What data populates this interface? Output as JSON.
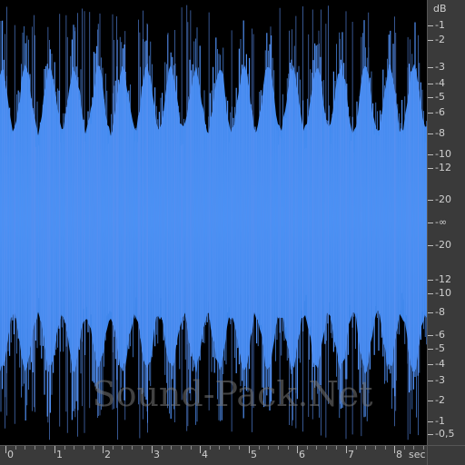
{
  "colors": {
    "waveform": "#4f8ff2",
    "waveform_core": "#3f88ee",
    "background": "#000000",
    "ruler_bg": "#3a3a3a",
    "label": "#cfcfcf"
  },
  "db_scale": {
    "unit_label": "dB",
    "labels": [
      "-1",
      "-2",
      "-3",
      "-4",
      "-5",
      "-6",
      "-8",
      "-10",
      "-12",
      "-20",
      "-∞",
      "-20",
      "-12",
      "-10",
      "-8",
      "-6",
      "-5",
      "-4",
      "-3",
      "-2",
      "-1",
      "-0,5"
    ]
  },
  "time_ruler": {
    "labels": [
      "0",
      "1",
      "2",
      "3",
      "4",
      "5",
      "6",
      "7",
      "8"
    ],
    "unit_label": "sec"
  },
  "watermark": "Sound-Pack.Net"
}
